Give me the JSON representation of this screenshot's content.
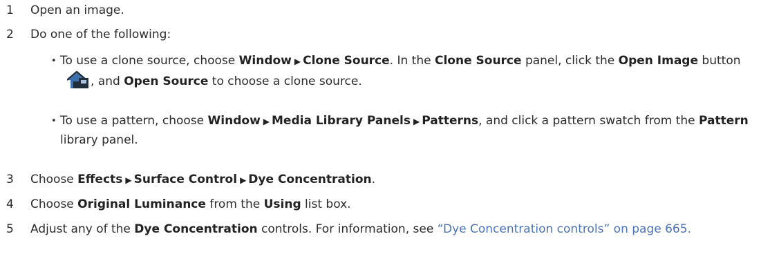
{
  "steps": [
    {
      "num": "1",
      "text": "Open an image."
    },
    {
      "num": "2",
      "text": "Do one of the following:"
    },
    {
      "num": "3",
      "pre": "Choose",
      "m1": "Effects",
      "m2": "Surface Control",
      "m3": "Dye Concentration",
      "post": "."
    },
    {
      "num": "4",
      "pre": "Choose",
      "b1": "Original Luminance",
      "mid": "from the",
      "b2": "Using",
      "post": "list box."
    },
    {
      "num": "5",
      "pre": "Adjust any of the",
      "b1": "Dye Concentration",
      "mid": "controls. For information, see",
      "link": "“Dye Concentration controls” on page 665",
      "post": "."
    }
  ],
  "bullets": [
    {
      "t1": "To use a clone source, choose",
      "m1": "Window",
      "m2": "Clone Source",
      "t2": ". In the",
      "b1": "Clone Source",
      "t3": "panel, click the",
      "b2": "Open Image",
      "t4": "button",
      "t5": ", and",
      "b3": "Open Source",
      "t6": "to choose a clone source.",
      "icon": "open-image-house-icon"
    },
    {
      "t1": "To use a pattern, choose",
      "m1": "Window",
      "m2": "Media Library Panels",
      "m3": "Patterns",
      "t2": ", and click a pattern swatch from the",
      "b1": "Pattern",
      "t3": "library panel."
    }
  ],
  "colors": {
    "text": "#2b2b2b",
    "link": "#4b74b6",
    "icon_blue": "#3a6fb0",
    "icon_dark": "#1f2d3d"
  }
}
